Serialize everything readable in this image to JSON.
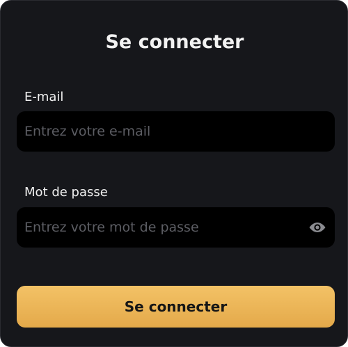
{
  "form": {
    "title": "Se connecter",
    "email": {
      "label": "E-mail",
      "placeholder": "Entrez votre e-mail",
      "value": ""
    },
    "password": {
      "label": "Mot de passe",
      "placeholder": "Entrez votre mot de passe",
      "value": "",
      "toggle_icon": "eye-icon"
    },
    "submit_label": "Se connecter"
  },
  "colors": {
    "card_background": "#16171b",
    "input_background": "#000000",
    "placeholder": "#5c5d63",
    "accent_top": "#f3c266",
    "accent_bottom": "#e4a94a",
    "text": "#f2f2f2"
  }
}
